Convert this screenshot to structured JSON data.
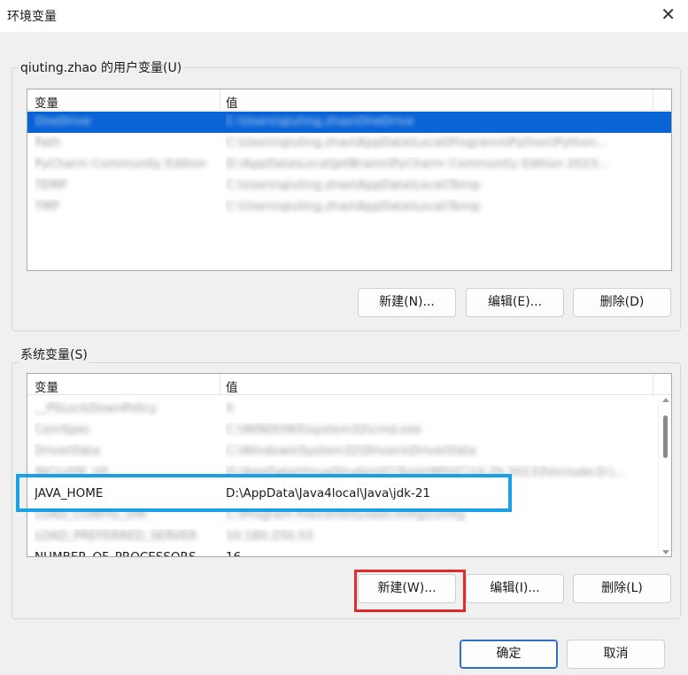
{
  "window": {
    "title": "环境变量",
    "close_glyph": "✕"
  },
  "user_vars": {
    "group_label": "qiuting.zhao 的用户变量(U)",
    "columns": {
      "variable": "变量",
      "value": "值"
    },
    "rows": [
      {
        "variable": "OneDrive",
        "value": "C:\\Users\\qiuting.zhao\\OneDrive",
        "selected": true
      },
      {
        "variable": "Path",
        "value": "C:\\Users\\qiuting.zhao\\AppData\\Local\\Programs\\Python\\Python...",
        "selected": false
      },
      {
        "variable": "PyCharm Community Edition",
        "value": "D:\\AppData\\Local\\JetBrains\\PyCharm Community Edition 2023...",
        "selected": false
      },
      {
        "variable": "TEMP",
        "value": "C:\\Users\\qiuting.zhao\\AppData\\Local\\Temp",
        "selected": false
      },
      {
        "variable": "TMP",
        "value": "C:\\Users\\qiuting.zhao\\AppData\\Local\\Temp",
        "selected": false
      }
    ],
    "buttons": {
      "new": "新建(N)...",
      "edit": "编辑(E)...",
      "delete": "删除(D)"
    }
  },
  "system_vars": {
    "group_label": "系统变量(S)",
    "columns": {
      "variable": "变量",
      "value": "值"
    },
    "rows": [
      {
        "variable": "__PSLockDownPolicy",
        "value": "0"
      },
      {
        "variable": "ComSpec",
        "value": "C:\\WINDOWS\\system32\\cmd.exe"
      },
      {
        "variable": "DriverData",
        "value": "C:\\Windows\\System32\\Drivers\\DriverData"
      },
      {
        "variable": "INCLUDE_VS",
        "value": "D:\\AppData\\VisualStudio\\VC\\Tools\\MSVC\\14.29.30133\\include;D:\\..."
      },
      {
        "variable": "JAVA_HOME",
        "value": "D:\\AppData\\Java4local\\Java\\jdk-21"
      },
      {
        "variable": "LOAD_CONFIG_DIR",
        "value": "C:\\Program Files\\Intel\\LoadConfig\\config"
      },
      {
        "variable": "LOAD_PREFERRED_SERVER",
        "value": "10.180.250.53"
      },
      {
        "variable": "NUMBER_OF_PROCESSORS",
        "value": "16"
      }
    ],
    "buttons": {
      "new": "新建(W)...",
      "edit": "编辑(I)...",
      "delete": "删除(L)"
    }
  },
  "footer": {
    "ok": "确定",
    "cancel": "取消"
  },
  "colors": {
    "selection": "#0a64d6",
    "highlight_blue": "#1aa0e6",
    "highlight_red": "#e12a2a"
  }
}
